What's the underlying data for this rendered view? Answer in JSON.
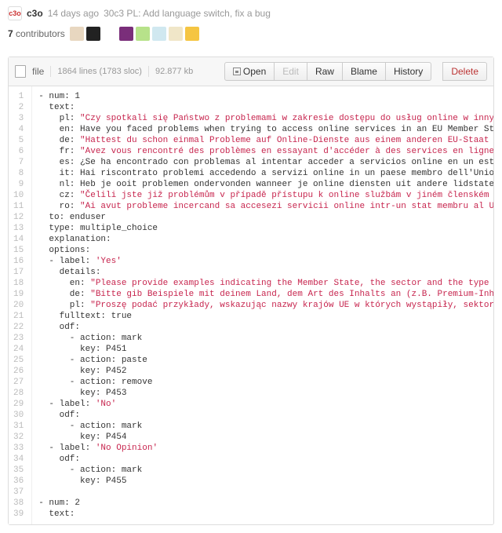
{
  "commit": {
    "author": "c3o",
    "author_initials": "c3o",
    "age": "14 days ago",
    "message": "30c3 PL: Add language switch, fix a bug"
  },
  "contributors": {
    "countStrong": "7",
    "label": "contributors"
  },
  "toolbar": {
    "file_label": "file",
    "lines": "1864 lines (1783 sloc)",
    "size": "92.877 kb",
    "open": "Open",
    "edit": "Edit",
    "raw": "Raw",
    "blame": "Blame",
    "history": "History",
    "delete": "Delete"
  },
  "code": {
    "lines": [
      {
        "t": "- num: 1"
      },
      {
        "t": "  text:"
      },
      {
        "i": "    pl: ",
        "s": "\"Czy spotkali się Państwo z problemami w zakresie dostępu do usług online w innym państwie członkowskim Unii Europe"
      },
      {
        "t": "    en: Have you faced problems when trying to access online services in an EU Member State other than the one in which you"
      },
      {
        "i": "    de: ",
        "s": "\"Hattest du schon einmal Probleme auf Online-Dienste aus einem anderen EU-Staat als dem, in dem du lebst, zuzugrei"
      },
      {
        "i": "    fr: ",
        "s": "\"Avez vous rencontré des problèmes en essayant d'accéder à des services en ligne venant d'un autre pays membre de "
      },
      {
        "t": "    es: ¿Se ha encontrado con problemas al intentar acceder a servicios online en un estado miembro de la Unión Europea di"
      },
      {
        "t": "    it: Hai riscontrato problemi accedendo a servizi online in un paese membro dell'Unione europea, apparte quello in cui "
      },
      {
        "t": "    nl: Heb je ooit problemen ondervonden wanneer je online diensten uit andere lidstaten dan jouw eigen land probeert te "
      },
      {
        "i": "    cz: ",
        "s": "\"Čelili jste již problémům v případě přístupu k online službám v jiném členském státě, než je vaše vlast?\""
      },
      {
        "i": "    ro: ",
        "s": "\"Ai avut probleme incercand sa accesezi servicii online intr-un stat membru al UE altul decat cel in care locuiesti"
      },
      {
        "t": "  to: enduser"
      },
      {
        "t": "  type: multiple_choice"
      },
      {
        "t": "  explanation:"
      },
      {
        "t": "  options:"
      },
      {
        "i": "  - label: ",
        "s": "'Yes'"
      },
      {
        "t": "    details:"
      },
      {
        "i": "      en: ",
        "s": "\"Please provide examples indicating the Member State, the sector and the type of content concerned (e.g. premium"
      },
      {
        "i": "      de: ",
        "s": "\"Bitte gib Beispiele mit deinem Land, dem Art des Inhalts an (z.B. Premium-Inhalte wie bestimmte Filme, TV-Serien"
      },
      {
        "i": "      pl: ",
        "s": "\"Proszę podać przykłady, wskazując nazwy krajów UE w których wystąpiły, sektor działalności oraz rodzaj treści k"
      },
      {
        "t": "    fulltext: true"
      },
      {
        "t": "    odf:"
      },
      {
        "t": "      - action: mark"
      },
      {
        "t": "        key: P451"
      },
      {
        "t": "      - action: paste"
      },
      {
        "t": "        key: P452"
      },
      {
        "t": "      - action: remove"
      },
      {
        "t": "        key: P453"
      },
      {
        "i": "  - label: ",
        "s": "'No'"
      },
      {
        "t": "    odf:"
      },
      {
        "t": "      - action: mark"
      },
      {
        "t": "        key: P454"
      },
      {
        "i": "  - label: ",
        "s": "'No Opinion'"
      },
      {
        "t": "    odf:"
      },
      {
        "t": "      - action: mark"
      },
      {
        "t": "        key: P455"
      },
      {
        "t": ""
      },
      {
        "t": "- num: 2"
      },
      {
        "t": "  text:"
      }
    ]
  },
  "avatars": [
    {
      "bg": "#e8d7c0"
    },
    {
      "bg": "#222"
    },
    {
      "bg": "#ffffff"
    },
    {
      "bg": "#7a2e7a"
    },
    {
      "bg": "#b7e28a"
    },
    {
      "bg": "#d0e8f0"
    },
    {
      "bg": "#f0e6c8"
    },
    {
      "bg": "#f5c542"
    }
  ]
}
